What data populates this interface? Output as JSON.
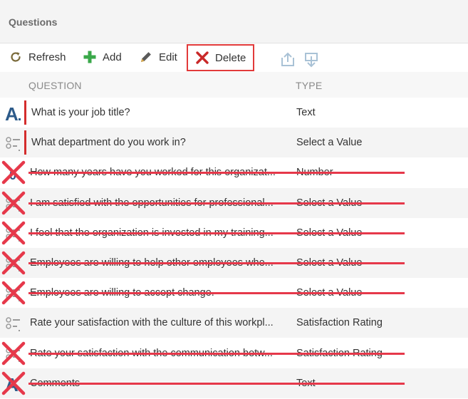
{
  "header": {
    "title": "Questions"
  },
  "toolbar": {
    "refresh_label": "Refresh",
    "add_label": "Add",
    "edit_label": "Edit",
    "delete_label": "Delete"
  },
  "columns": {
    "question": "QUESTION",
    "type": "TYPE"
  },
  "rows": [
    {
      "question": "What is your job title?",
      "type": "Text",
      "icon": "text-type-icon",
      "marker": true,
      "struck": false
    },
    {
      "question": "What department do you work in?",
      "type": "Select a Value",
      "icon": "select-list-icon",
      "marker": true,
      "struck": false
    },
    {
      "question": "How many years have you worked for this organizat...",
      "type": "Number",
      "icon": "number-type-icon",
      "marker": false,
      "struck": true
    },
    {
      "question": "I am satisfied with the opportunities for professional...",
      "type": "Select a Value",
      "icon": "select-list-icon",
      "marker": false,
      "struck": true
    },
    {
      "question": "I feel that the organization is invested in my training...",
      "type": "Select a Value",
      "icon": "select-list-icon",
      "marker": false,
      "struck": true
    },
    {
      "question": "Employees are willing to help other employees whe...",
      "type": "Select a Value",
      "icon": "select-list-icon",
      "marker": false,
      "struck": true
    },
    {
      "question": "Employees are willing to accept change.",
      "type": "Select a Value",
      "icon": "select-list-icon",
      "marker": false,
      "struck": true
    },
    {
      "question": "Rate your satisfaction with the culture of this workpl...",
      "type": "Satisfaction Rating",
      "icon": "select-list-icon",
      "marker": false,
      "struck": false
    },
    {
      "question": "Rate your satisfaction with the communication betw...",
      "type": "Satisfaction Rating",
      "icon": "select-list-icon",
      "marker": false,
      "struck": true
    },
    {
      "question": "Comments",
      "type": "Text",
      "icon": "text-type-icon",
      "marker": false,
      "struck": true
    }
  ],
  "colors": {
    "delete_highlight": "#e23a3a",
    "strike": "#e6384a",
    "marker": "#d42d2d",
    "add_green": "#3aa84a"
  }
}
